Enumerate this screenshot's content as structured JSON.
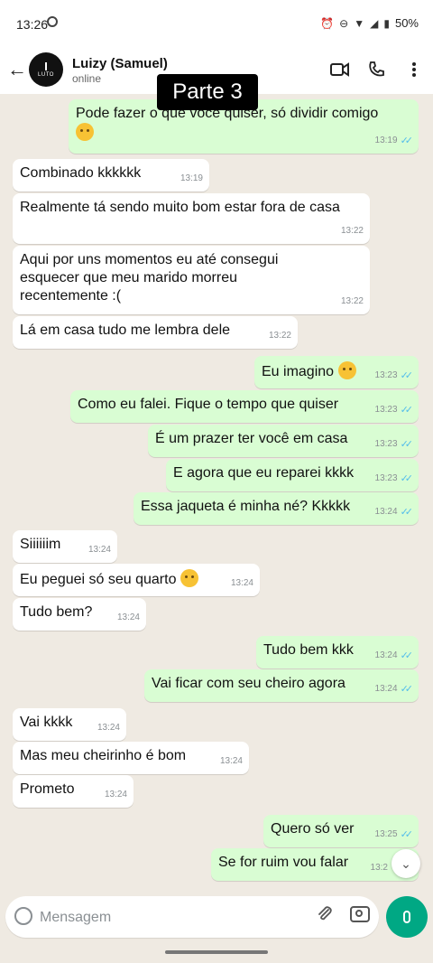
{
  "status_bar": {
    "time": "13:26",
    "battery": "50%"
  },
  "header": {
    "contact_name": "Luizy (Samuel)",
    "contact_status": "online",
    "avatar_text": "LUTO"
  },
  "overlay": {
    "label": "Parte 3"
  },
  "messages": [
    {
      "dir": "out",
      "text": "Pode fazer o que você quiser, só dividir comigo",
      "time": "13:19"
    },
    {
      "dir": "in",
      "text": "Combinado kkkkkk",
      "time": "13:19"
    },
    {
      "dir": "in",
      "text": "Realmente tá sendo muito bom estar fora de casa",
      "time": "13:22"
    },
    {
      "dir": "in",
      "text": "Aqui por uns momentos eu até consegui esquecer que meu marido morreu recentemente :(",
      "time": "13:22"
    },
    {
      "dir": "in",
      "text": "Lá em casa tudo me lembra dele",
      "time": "13:22"
    },
    {
      "dir": "out",
      "text": "Eu imagino",
      "time": "13:23"
    },
    {
      "dir": "out",
      "text": "Como eu falei. Fique o tempo que quiser",
      "time": "13:23"
    },
    {
      "dir": "out",
      "text": "É um prazer ter você em casa",
      "time": "13:23"
    },
    {
      "dir": "out",
      "text": "E agora que eu reparei kkkk",
      "time": "13:23"
    },
    {
      "dir": "out",
      "text": "Essa jaqueta é minha né? Kkkkk",
      "time": "13:24"
    },
    {
      "dir": "in",
      "text": "Siiiiiim",
      "time": "13:24"
    },
    {
      "dir": "in",
      "text": "Eu peguei só seu quarto",
      "time": "13:24"
    },
    {
      "dir": "in",
      "text": "Tudo bem?",
      "time": "13:24"
    },
    {
      "dir": "out",
      "text": "Tudo bem kkk",
      "time": "13:24"
    },
    {
      "dir": "out",
      "text": "Vai ficar com seu cheiro agora",
      "time": "13:24"
    },
    {
      "dir": "in",
      "text": "Vai kkkk",
      "time": "13:24"
    },
    {
      "dir": "in",
      "text": "Mas meu cheirinho é bom",
      "time": "13:24"
    },
    {
      "dir": "in",
      "text": "Prometo",
      "time": "13:24"
    },
    {
      "dir": "out",
      "text": "Quero só ver",
      "time": "13:25"
    },
    {
      "dir": "out",
      "text": "Se for ruim vou falar",
      "time": "13:2"
    }
  ],
  "input": {
    "placeholder": "Mensagem"
  },
  "icons": {
    "video": "video-call-icon",
    "voice": "voice-call-icon",
    "menu": "more-vert-icon",
    "attach": "paperclip-icon",
    "camera": "camera-icon",
    "mic": "mic-icon"
  },
  "colors": {
    "outgoing": "#d9fdd3",
    "incoming": "#ffffff",
    "accent": "#00a884",
    "read_ticks": "#53bdeb"
  }
}
